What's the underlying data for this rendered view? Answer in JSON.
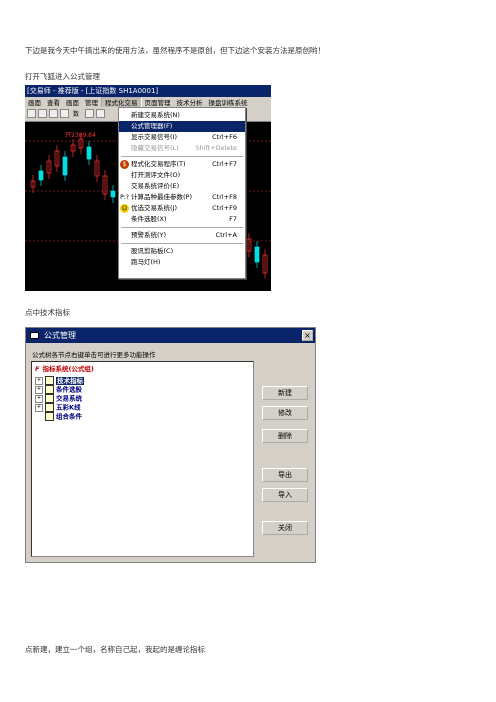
{
  "doc": {
    "intro": "下边是我今天中午搞出来的使用方法，虽然程序不是原创，但下边这个安装方法是原创哟！",
    "step1": "打开飞狐进入公式管理",
    "step2": "点中技术指标",
    "step3": "点新建，建立一个组，名称自己起，我起的是缠论指标"
  },
  "shot1": {
    "window_title": "[交易师 - 推荐版 - [上证指数 SH1A0001]",
    "menus": [
      "画面",
      "查看",
      "画面",
      "管理",
      "程式化交易",
      "页面管理",
      "技术分析",
      "操盘训练系统"
    ],
    "active_menu_index": 4,
    "toolbar_label": "数",
    "chart_label": "开2389.84",
    "dropdown": [
      {
        "label": "新建交易系统(N)",
        "shortcut": "",
        "icon": ""
      },
      {
        "label": "公式管理器(F)",
        "shortcut": "",
        "icon": "",
        "selected": true
      },
      {
        "label": "显示交易信号(I)",
        "shortcut": "Ctrl+F6",
        "icon": ""
      },
      {
        "label": "隐藏交易信号(L)",
        "shortcut": "Shift+Delete",
        "icon": "",
        "disabled": true
      },
      {
        "sep": true
      },
      {
        "label": "程式化交易程序(T)",
        "shortcut": "Ctrl+F7",
        "icon": "$"
      },
      {
        "label": "打开测评文件(O)",
        "shortcut": "",
        "icon": ""
      },
      {
        "label": "交易系统评价(E)",
        "shortcut": "",
        "icon": ""
      },
      {
        "label": "计算品种最佳参数(P)",
        "shortcut": "Ctrl+F8",
        "icon": "P:?"
      },
      {
        "label": "优选交易系统(J)",
        "shortcut": "Ctrl+F9",
        "icon": "☺"
      },
      {
        "label": "条件选股(X)",
        "shortcut": "F7",
        "icon": ""
      },
      {
        "sep": true
      },
      {
        "label": "预警系统(Y)",
        "shortcut": "Ctrl+A",
        "icon": ""
      },
      {
        "sep": true
      },
      {
        "label": "股讯剪贴板(C)",
        "shortcut": "",
        "icon": ""
      },
      {
        "label": "跑马灯(H)",
        "shortcut": "",
        "icon": ""
      }
    ]
  },
  "shot2": {
    "title": "公式管理",
    "close_glyph": "×",
    "hint": "公式树各节点右键单击可进行更多功能操作",
    "root": {
      "label": "指标系统(公式组)",
      "icon": "F"
    },
    "nodes": [
      {
        "label": "技术指标",
        "expand": "+",
        "highlighted": true
      },
      {
        "label": "条件选股",
        "expand": "+"
      },
      {
        "label": "交易系统",
        "expand": "+"
      },
      {
        "label": "五彩K线",
        "expand": "+"
      },
      {
        "label": "组合条件",
        "expand": ""
      }
    ],
    "buttons": [
      "新建",
      "修改",
      "删除",
      "导出",
      "导入",
      "关闭"
    ]
  }
}
